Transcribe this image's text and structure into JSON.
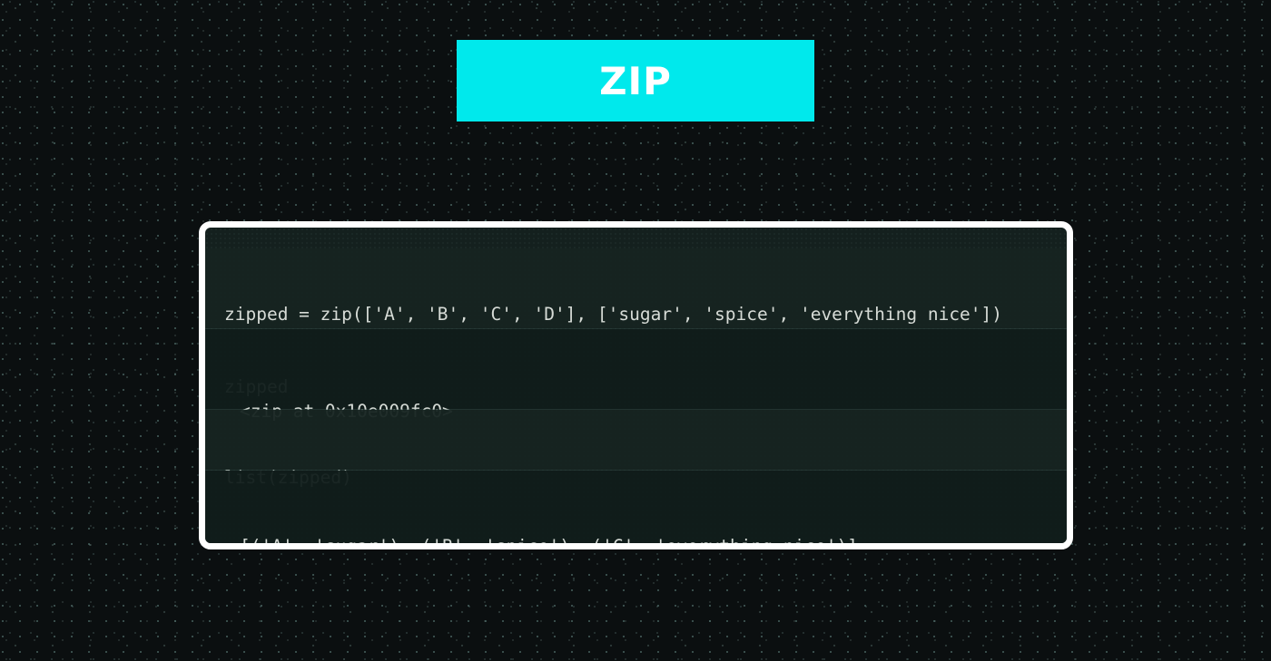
{
  "title": "ZIP",
  "code_block": {
    "input_1": {
      "lines": [
        "zipped = zip(['A', 'B', 'C', 'D'], ['sugar', 'spice', 'everything nice'])",
        "zipped"
      ]
    },
    "output_1": "<zip at 0x10e009fc0>",
    "input_2": "list(zipped)",
    "output_2": "[('A', 'sugar'), ('B', 'spice'), ('C', 'everything nice')]"
  },
  "colors": {
    "banner": "#00e9ec",
    "background": "#0b0f10",
    "card_border": "#ffffff",
    "card_background": "#14201e",
    "code_text": "#d6dbd6"
  }
}
